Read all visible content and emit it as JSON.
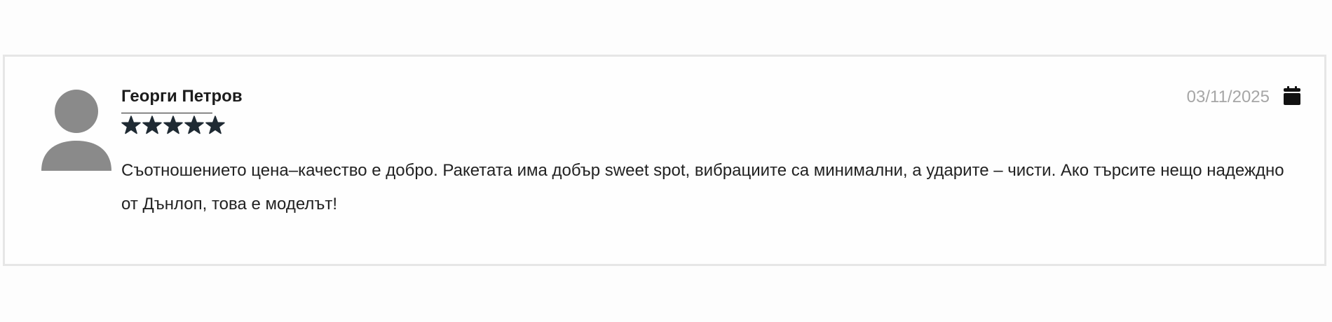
{
  "review": {
    "author": "Георги Петров",
    "rating": 5,
    "rating_max": 5,
    "date": "03/11/2025",
    "text": "Съотношението цена–качество е добро. Ракетата има добър sweet spot, вибрациите са минимални, а ударите – чисти. Ако търсите нещо надеждно от Дънлоп, това е моделът!",
    "icons": {
      "avatar": "user-avatar-icon",
      "date": "calendar-icon",
      "rating": "star-icon"
    },
    "colors": {
      "star": "#1f2a33",
      "avatar": "#8a8a8a",
      "date": "#a6a6a6",
      "border": "#e6e6e6"
    }
  }
}
